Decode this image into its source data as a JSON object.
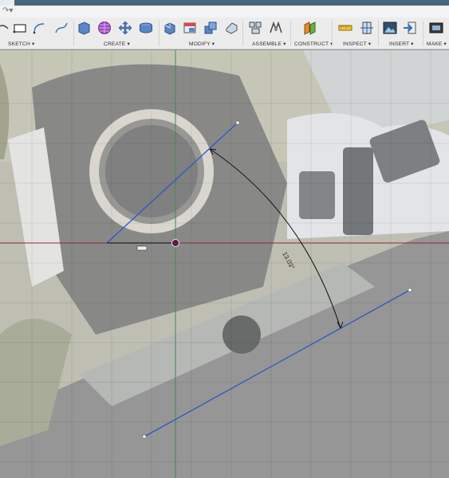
{
  "quick_access": {
    "redo_icon": "redo-icon"
  },
  "ribbon": {
    "groups": [
      {
        "label": "SKETCH ▾"
      },
      {
        "label": "CREATE ▾"
      },
      {
        "label": "MODIFY ▾"
      },
      {
        "label": "ASSEMBLE ▾"
      },
      {
        "label": "CONSTRUCT ▾"
      },
      {
        "label": "INSPECT ▾"
      },
      {
        "label": "INSERT ▾"
      },
      {
        "label": "MAKE ▾"
      }
    ]
  },
  "canvas": {
    "dimension_text": "13.03°",
    "colors": {
      "sketch_line": "#3056c8",
      "dimension": "#111111",
      "axis_red": "#8a2b33",
      "axis_green": "#3f8a52"
    }
  }
}
